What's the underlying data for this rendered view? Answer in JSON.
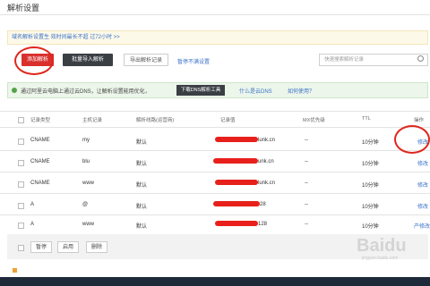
{
  "header": {
    "title": "解析设置"
  },
  "notice": {
    "text": "域名解析设置生 效时间最长不超 过72小时 >>"
  },
  "toolbar": {
    "add_label": "添加解析",
    "batch_add_label": "批量导入解析",
    "export_label": "导出解析记录",
    "link_label": "暂停不满设置",
    "search_placeholder": "快速搜索解析记录"
  },
  "info": {
    "text": "通过阿里云电脑上通过云DNS，让解析设置能用优化，",
    "button_label": "下载DNS解析工具",
    "link1": "什么是云DNS",
    "link2": "如何使用？"
  },
  "table": {
    "columns": [
      "记录类型",
      "主机记录",
      "解析线路(运营商)",
      "记录值",
      "MX优先级",
      "TTL",
      "操作"
    ],
    "rows": [
      {
        "type": "CNAME",
        "host": "my",
        "line": "默认",
        "value_suffix": "lunk.cn",
        "mx": "--",
        "ttl": "10分钟",
        "op": "修改"
      },
      {
        "type": "CNAME",
        "host": "blu",
        "line": "默认",
        "value_suffix": "unk.cn",
        "mx": "--",
        "ttl": "10分钟",
        "op": "修改"
      },
      {
        "type": "CNAME",
        "host": "www",
        "line": "默认",
        "value_suffix": "lunk.cn",
        "mx": "--",
        "ttl": "10分钟",
        "op": "修改"
      },
      {
        "type": "A",
        "host": "@",
        "line": "默认",
        "value_suffix": "28",
        "mx": "--",
        "ttl": "10分钟",
        "op": "修改"
      },
      {
        "type": "A",
        "host": "www",
        "line": "默认",
        "value_suffix": "128",
        "mx": "--",
        "ttl": "10分钟",
        "op": "产修改"
      }
    ]
  },
  "footer": {
    "pause_label": "暂停",
    "enable_label": "启用",
    "delete_label": "删除"
  },
  "watermark": {
    "logo": "Baidu",
    "sub": "jingyan.baidu.com"
  },
  "colors": {
    "accent_red": "#d9302e",
    "link_blue": "#3a72c8",
    "info_green": "#52a447"
  }
}
